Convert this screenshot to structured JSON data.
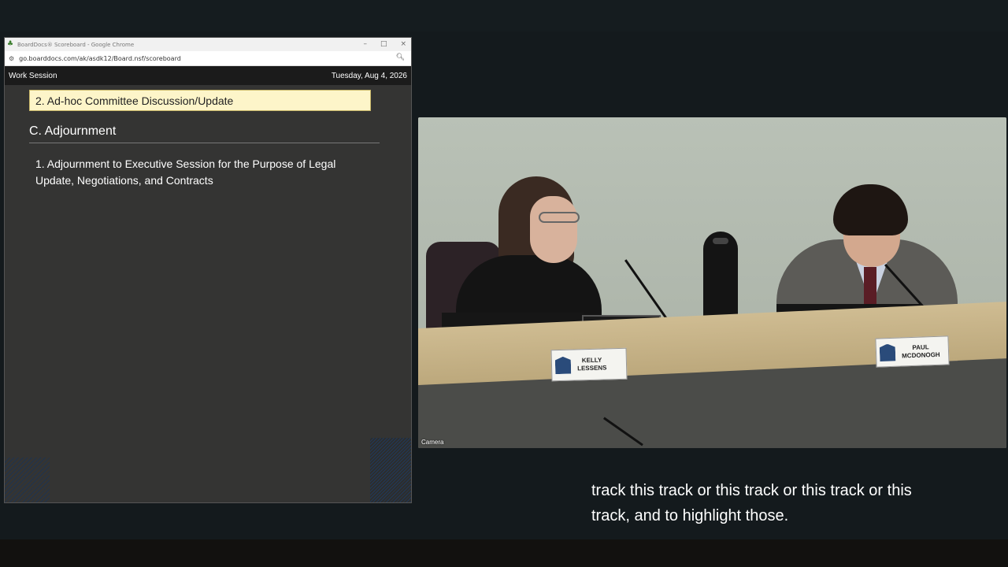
{
  "browser": {
    "window_title": "BoardDocs® Scoreboard - Google Chrome",
    "url": "go.boarddocs.com/ak/asdk12/Board.nsf/scoreboard",
    "controls": {
      "minimize": "–",
      "maximize": "□",
      "close": "×"
    }
  },
  "boarddocs": {
    "meeting_type": "Work Session",
    "date": "Tuesday, Aug 4, 2026",
    "current_item": "2. Ad-hoc Committee Discussion/Update",
    "section_heading": "C. Adjournment",
    "items": [
      "1. Adjournment to Executive Session for the Purpose of Legal Update, Negotiations, and Contracts"
    ]
  },
  "camera": {
    "label": "Camera",
    "nameplates": [
      {
        "name": "KELLY\nLESSENS"
      },
      {
        "name": "PAUL\nMCDONOGH"
      }
    ]
  },
  "caption": {
    "line1": "track this track or this track or this track or this",
    "line2": "track, and to highlight those."
  },
  "colors": {
    "highlight_item_bg": "#fdf5c9",
    "board_bg": "#343433",
    "header_bg": "#1b1b1b"
  }
}
